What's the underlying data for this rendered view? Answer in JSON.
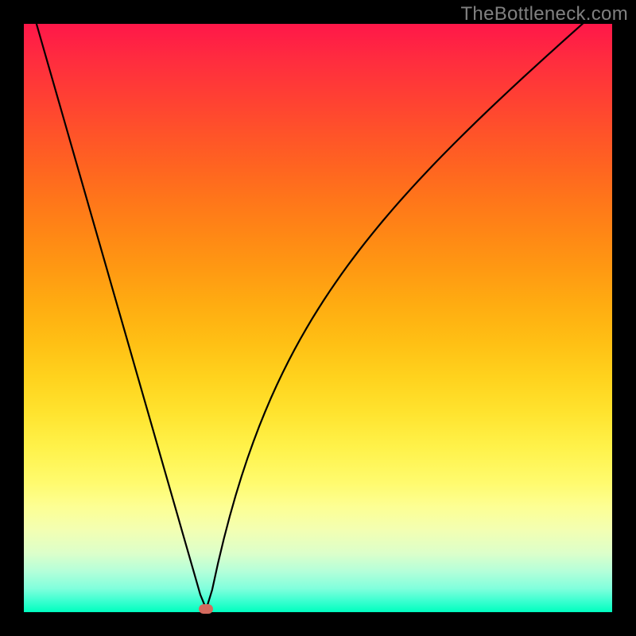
{
  "attribution": "TheBottleneck.com",
  "chart_data": {
    "type": "line",
    "title": "",
    "xlabel": "",
    "ylabel": "",
    "xlim": [
      0,
      100
    ],
    "ylim": [
      0,
      100
    ],
    "x": [
      0,
      1,
      2,
      3,
      4,
      5,
      6,
      7,
      8,
      9,
      10,
      11,
      12,
      13,
      14,
      15,
      16,
      17,
      18,
      19,
      20,
      21,
      22,
      23,
      24,
      25,
      26,
      27,
      28,
      29,
      30,
      31,
      32,
      33,
      34,
      35,
      36,
      37,
      38,
      39,
      40,
      41,
      42,
      43,
      44,
      45,
      46,
      47,
      48,
      49,
      50,
      51,
      52,
      53,
      54,
      55,
      56,
      57,
      58,
      59,
      60,
      61,
      62,
      63,
      64,
      65,
      66,
      67,
      68,
      69,
      70,
      71,
      72,
      73,
      74,
      75,
      76,
      77,
      78,
      79,
      80,
      81,
      82,
      83,
      84,
      85,
      86,
      87,
      88,
      89,
      90,
      91,
      92,
      93,
      94,
      95,
      96,
      97,
      98,
      99,
      100
    ],
    "values": [
      107.479,
      103.995,
      100.511,
      97.027,
      93.543,
      90.059,
      86.575,
      83.091,
      79.607,
      76.122,
      72.638,
      69.154,
      65.67,
      62.186,
      58.702,
      55.218,
      51.734,
      48.25,
      44.766,
      41.282,
      37.798,
      34.314,
      30.83,
      27.346,
      23.862,
      20.378,
      16.894,
      13.409,
      9.925,
      6.441,
      2.957,
      0.526,
      3.754,
      8.312,
      12.477,
      16.299,
      19.82,
      23.078,
      26.104,
      28.926,
      31.567,
      34.049,
      36.389,
      38.602,
      40.702,
      42.701,
      44.608,
      46.433,
      48.183,
      49.866,
      51.488,
      53.054,
      54.569,
      56.037,
      57.462,
      58.848,
      60.197,
      61.513,
      62.797,
      64.052,
      65.281,
      66.485,
      67.665,
      68.824,
      69.963,
      71.083,
      72.186,
      73.273,
      74.344,
      75.402,
      76.446,
      77.478,
      78.498,
      79.508,
      80.507,
      81.497,
      82.478,
      83.451,
      84.417,
      85.375,
      86.326,
      87.272,
      88.211,
      89.145,
      90.074,
      90.998,
      91.918,
      92.833,
      93.745,
      94.652,
      95.557,
      96.458,
      97.356,
      98.251,
      99.144,
      100.035,
      100.924,
      101.81,
      102.694,
      103.578,
      104.459
    ],
    "marker": {
      "x": 31,
      "y": 0.5
    },
    "background_gradient": "rainbow-vertical"
  }
}
